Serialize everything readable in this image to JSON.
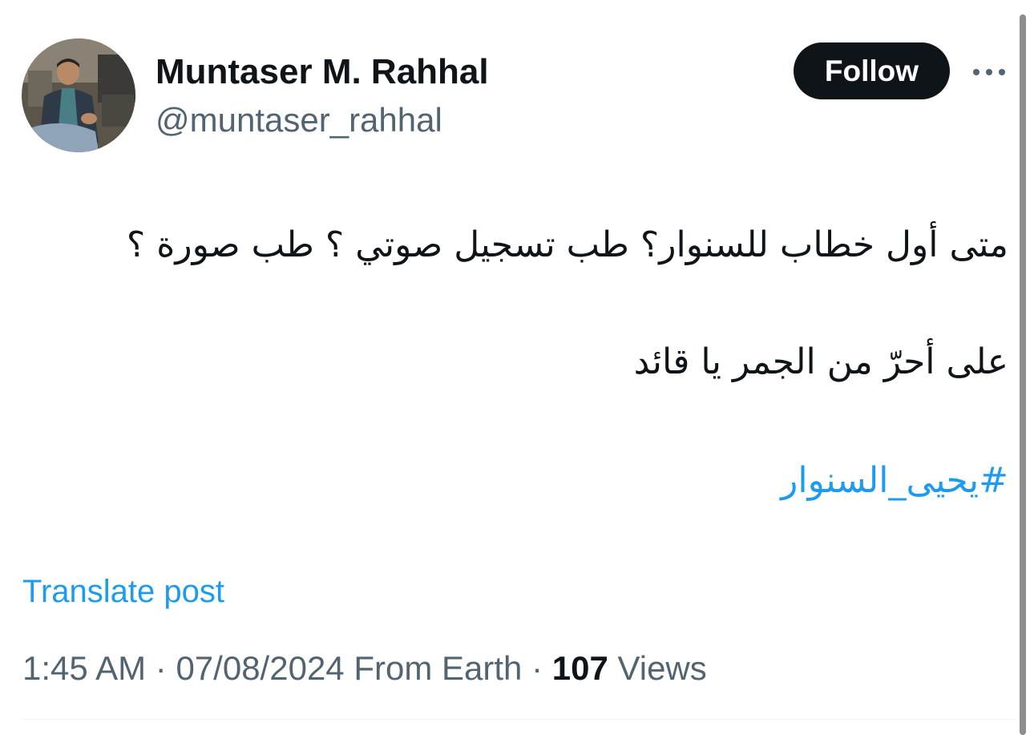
{
  "author": {
    "display_name": "Muntaser M. Rahhal",
    "handle": "@muntaser_rahhal",
    "avatar_icon": "person-photo-avatar"
  },
  "actions": {
    "follow_label": "Follow",
    "more_icon": "more-horizontal-icon"
  },
  "tweet": {
    "line1": "متى أول خطاب للسنوار؟ طب تسجيل صوتي ؟ طب صورة ؟",
    "line2": "على أحرّ من الجمر يا قائد",
    "hashtag": "#يحيى_السنوار"
  },
  "translate_label": "Translate post",
  "meta": {
    "time": "1:45 AM",
    "separator": "·",
    "date": "07/08/2024",
    "source": "From Earth",
    "views_count": "107",
    "views_label": "Views"
  },
  "colors": {
    "text": "#0f1419",
    "secondary": "#536471",
    "link": "#1d9bf0",
    "button_bg": "#0f1419"
  }
}
